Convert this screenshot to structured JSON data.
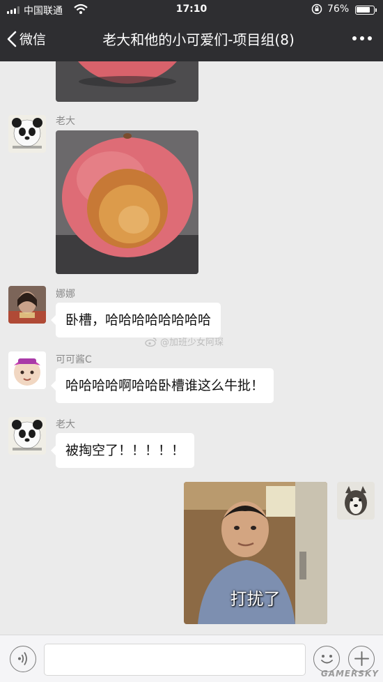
{
  "status_bar": {
    "carrier": "中国联通",
    "time": "17:10",
    "battery": "76%",
    "battery_level": 0.76,
    "wifi_icon": "wifi-icon",
    "lock_icon": "orientation-lock-icon"
  },
  "nav": {
    "back_label": "微信",
    "title": "老大和他的小可爱们-项目组(8)",
    "more_icon": "more-dots-icon"
  },
  "messages": [
    {
      "type": "image",
      "sender": "",
      "content": "photo of an apple (cropped)",
      "outgoing": false
    },
    {
      "type": "image",
      "sender": "老大",
      "content": "photo of a hollowed-out apple",
      "outgoing": false
    },
    {
      "type": "text",
      "sender": "娜娜",
      "text": "卧槽，哈哈哈哈哈哈哈哈",
      "outgoing": false
    },
    {
      "type": "text",
      "sender": "可可酱C",
      "text": "哈哈哈哈啊哈哈卧槽谁这么牛批！",
      "outgoing": false
    },
    {
      "type": "text",
      "sender": "老大",
      "text": "被掏空了！！！！！",
      "outgoing": false
    },
    {
      "type": "image",
      "sender": "",
      "caption": "打扰了",
      "content": "meme sticker of a boy peeking around a door",
      "outgoing": true
    }
  ],
  "watermark": "@加班少女阿琛",
  "input": {
    "placeholder": "",
    "value": "",
    "voice_icon": "voice-icon",
    "emoji_icon": "emoji-icon",
    "plus_icon": "plus-icon"
  },
  "logo": "GAMERSKY",
  "colors": {
    "header_bg": "#2e2e31",
    "chat_bg": "#ebebeb",
    "bubble_in": "#ffffff",
    "input_bar_bg": "#f5f5f7"
  }
}
